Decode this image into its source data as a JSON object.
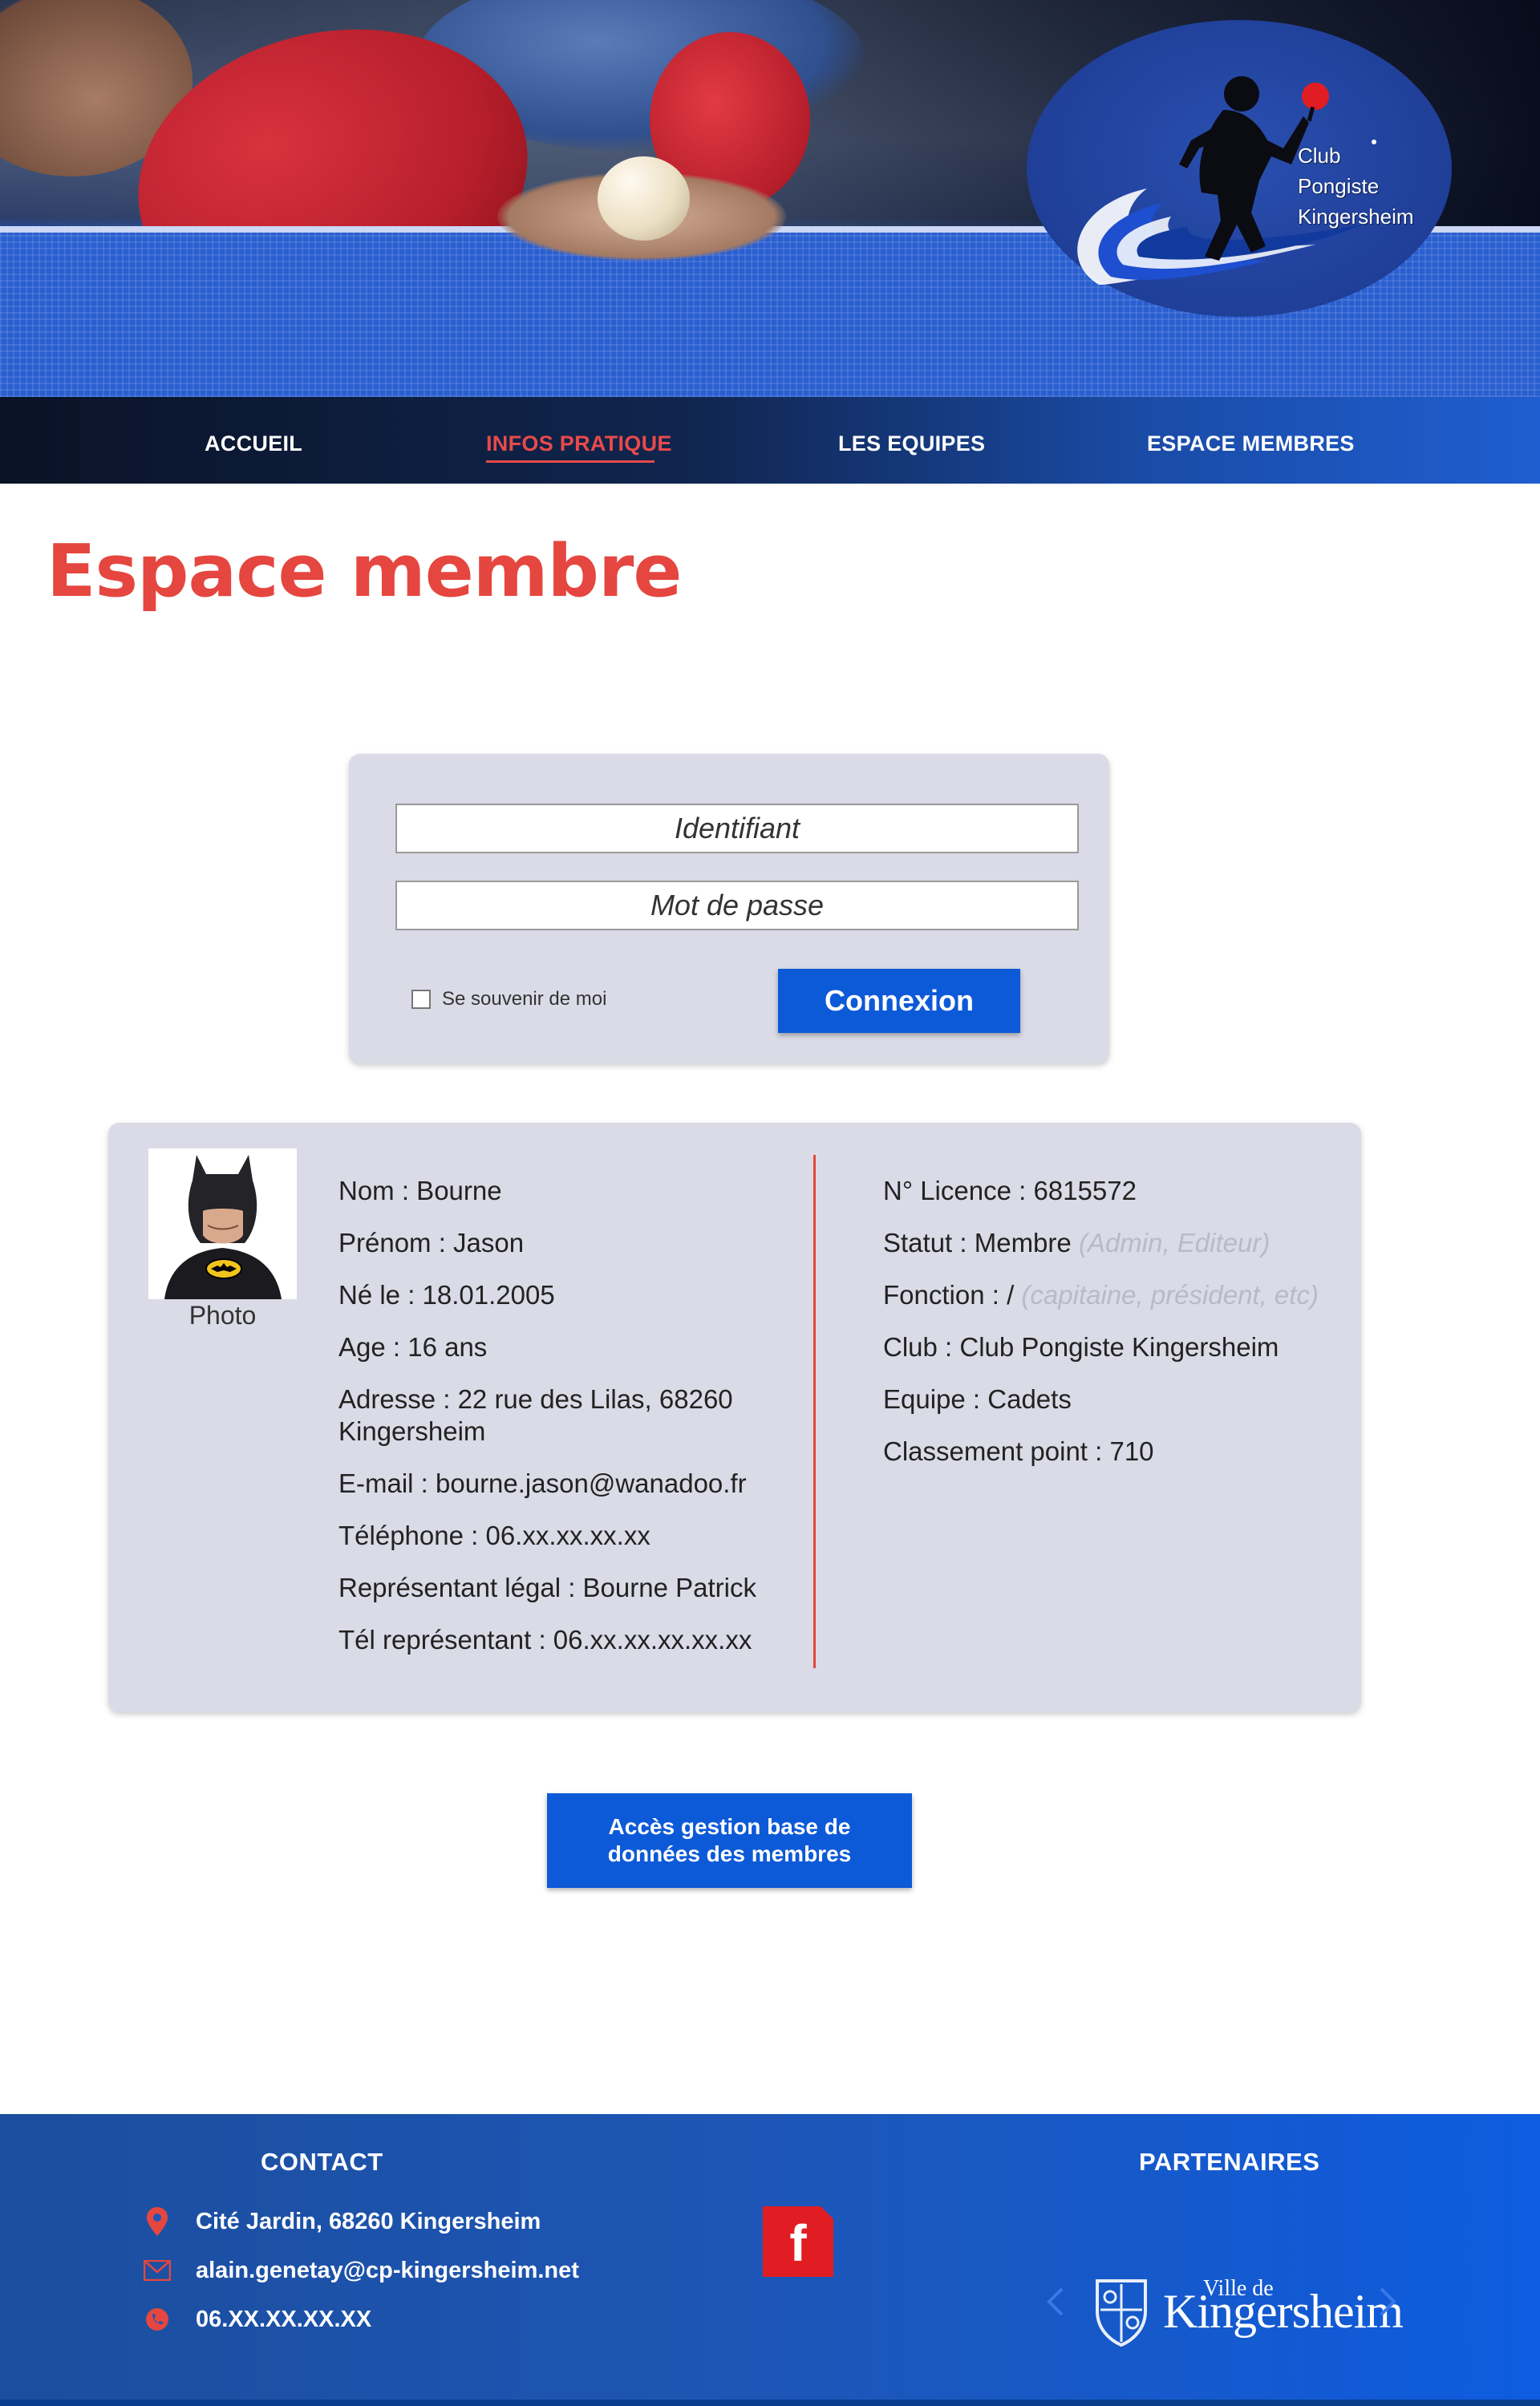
{
  "brand": {
    "logo_lines": [
      "Club",
      "Pongiste",
      "Kingersheim"
    ],
    "colors": {
      "accent": "#e5463f",
      "primary": "#0d5ad9",
      "nav_bg": "#10254f",
      "card_bg": "#dadbe6"
    }
  },
  "nav": {
    "items": [
      {
        "label": "ACCUEIL",
        "active": false
      },
      {
        "label": "INFOS PRATIQUE",
        "active": true
      },
      {
        "label": "LES EQUIPES",
        "active": false
      },
      {
        "label": "ESPACE MEMBRES",
        "active": false
      }
    ]
  },
  "page": {
    "title": "Espace membre"
  },
  "login": {
    "username_placeholder": "Identifiant",
    "password_placeholder": "Mot de passe",
    "remember_label": "Se souvenir de moi",
    "remember_checked": false,
    "submit_label": "Connexion"
  },
  "profile": {
    "photo_caption": "Photo",
    "left": [
      "Nom : Bourne",
      "Prénom : Jason",
      "Né le : 18.01.2005",
      "Age : 16 ans",
      "Adresse : 22 rue des Lilas, 68260 Kingersheim",
      "E-mail : bourne.jason@wanadoo.fr",
      "Téléphone : 06.xx.xx.xx.xx",
      "Représentant légal : Bourne Patrick",
      "Tél représentant : 06.xx.xx.xx.xx.xx"
    ],
    "right": {
      "licence": "N° Licence : 6815572",
      "statut": "Statut : Membre",
      "statut_hint": "(Admin, Editeur)",
      "fonction": "Fonction : /",
      "fonction_hint": "(capitaine, président, etc)",
      "club": "Club : Club Pongiste Kingersheim",
      "equipe": "Equipe : Cadets",
      "classement": "Classement point : 710"
    }
  },
  "admin_button": {
    "label": "Accès gestion base de données des membres"
  },
  "footer": {
    "contact_title": "CONTACT",
    "partners_title": "PARTENAIRES",
    "address": "Cité Jardin, 68260 Kingersheim",
    "email": "alain.genetay@cp-kingersheim.net",
    "phone": "06.XX.XX.XX.XX",
    "facebook_glyph": "f",
    "partner": {
      "small": "Ville de",
      "big": "Kingersheim"
    }
  },
  "icons": {
    "location": "location-pin-icon",
    "mail": "mail-icon",
    "phone": "phone-icon",
    "facebook": "facebook-icon",
    "prev": "chevron-left-icon",
    "next": "chevron-right-icon"
  }
}
